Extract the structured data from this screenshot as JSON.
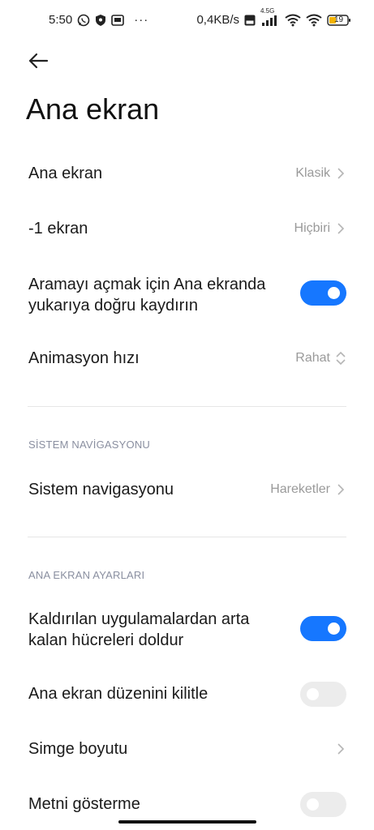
{
  "status_bar": {
    "time": "5:50",
    "ellipsis": "···",
    "net_speed": "0,4KB/s",
    "signal_label": "4.5G",
    "battery": "19"
  },
  "page": {
    "title": "Ana ekran"
  },
  "items": {
    "home_screen": {
      "label": "Ana ekran",
      "value": "Klasik"
    },
    "minus_one": {
      "label": "-1 ekran",
      "value": "Hiçbiri"
    },
    "swipe_search": {
      "label_line1": "Aramayı açmak için Ana ekranda",
      "label_line2": "yukarıya doğru kaydırın",
      "enabled": true
    },
    "animation_speed": {
      "label": "Animasyon hızı",
      "value": "Rahat"
    }
  },
  "system_nav": {
    "header": "SİSTEM NAVİGASYONU",
    "item": {
      "label": "Sistem navigasyonu",
      "value": "Hareketler"
    }
  },
  "home_settings": {
    "header": "ANA EKRAN AYARLARI",
    "fill_cells": {
      "label_line1": "Kaldırılan uygulamalardan arta",
      "label_line2": "kalan hücreleri doldur",
      "enabled": true
    },
    "lock_layout": {
      "label": "Ana ekran düzenini kilitle",
      "enabled": false
    },
    "icon_size": {
      "label": "Simge boyutu"
    },
    "hide_text": {
      "label": "Metni gösterme",
      "enabled": false
    }
  },
  "colors": {
    "accent": "#1677ff",
    "toggle_off": "#ececec",
    "muted_text": "#9a9a9a",
    "section_header": "#8a8fa0"
  }
}
